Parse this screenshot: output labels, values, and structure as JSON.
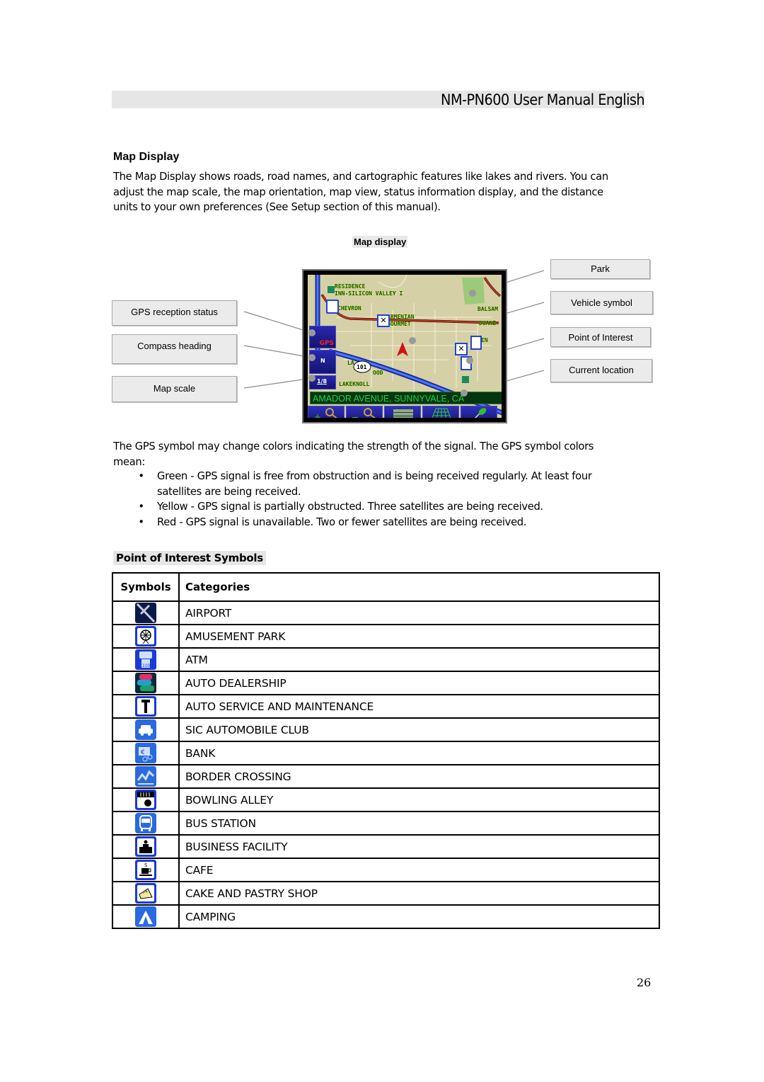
{
  "header": {
    "title": "NM-PN600 User Manual  English"
  },
  "map_display_section": {
    "title": "Map Display",
    "paragraph": "The Map Display shows roads, road names, and cartographic features like lakes and rivers.  You can adjust the map scale, the map orientation, map view, status information display, and the distance units to your own preferences (See Setup section of this manual).",
    "figure_caption": "Map display",
    "callouts_left": [
      "GPS reception status",
      "Compass heading",
      "Map scale"
    ],
    "callouts_right": [
      "Park",
      "Vehicle symbol",
      "Point of Interest",
      "Current location"
    ],
    "map": {
      "labels": [
        "RESIDENCE",
        "INN-SILICON VALLEY I",
        "CHEVRON",
        "ARMENIAN",
        "GOURMET",
        "BALSAM",
        "DUANE",
        "EN",
        "LA",
        "OOD",
        "LAKEKNOLL"
      ],
      "highway_shield": "101",
      "gps_label": "GPS",
      "compass_label": "N",
      "scale_label": "1/8",
      "current_location": "AMADOR AVENUE, SUNNYVALE, CA",
      "toolbar_buttons": [
        "zoom-in",
        "zoom-out",
        "menu",
        "3d-view",
        "pushpin"
      ]
    }
  },
  "gps_colors": {
    "intro": "The GPS symbol may change colors indicating the strength of the signal. The GPS symbol colors mean:",
    "items": [
      "Green - GPS signal is free from obstruction and is being received regularly.  At least four satellites are being received.",
      "Yellow - GPS signal is partially obstructed.  Three satellites are being received.",
      "Red - GPS signal is unavailable.  Two or fewer satellites are being received."
    ]
  },
  "poi_section": {
    "title": "Point of Interest Symbols",
    "columns": [
      "Symbols",
      "Categories"
    ],
    "rows": [
      {
        "icon": "airport-icon",
        "category": "AIRPORT"
      },
      {
        "icon": "amusement-park-icon",
        "category": "AMUSEMENT PARK"
      },
      {
        "icon": "atm-icon",
        "category": "ATM"
      },
      {
        "icon": "auto-dealership-icon",
        "category": "AUTO DEALERSHIP"
      },
      {
        "icon": "auto-service-icon",
        "category": "AUTO SERVICE AND MAINTENANCE"
      },
      {
        "icon": "automobile-club-icon",
        "category": "SIC AUTOMOBILE CLUB"
      },
      {
        "icon": "bank-icon",
        "category": "BANK"
      },
      {
        "icon": "border-crossing-icon",
        "category": "BORDER CROSSING"
      },
      {
        "icon": "bowling-alley-icon",
        "category": "BOWLING ALLEY"
      },
      {
        "icon": "bus-station-icon",
        "category": "BUS STATION"
      },
      {
        "icon": "business-facility-icon",
        "category": "BUSINESS FACILITY"
      },
      {
        "icon": "cafe-icon",
        "category": "CAFE"
      },
      {
        "icon": "cake-pastry-icon",
        "category": "CAKE AND PASTRY SHOP"
      },
      {
        "icon": "camping-icon",
        "category": "CAMPING"
      }
    ]
  },
  "footer": {
    "page_number": "26"
  }
}
